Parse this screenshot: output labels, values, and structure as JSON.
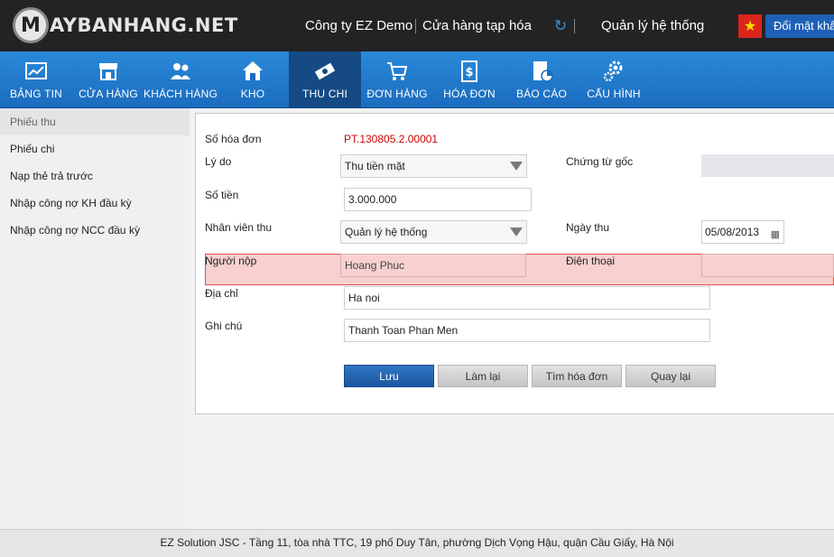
{
  "header": {
    "logo_letter": "M",
    "logo_text": "AYBANHANG.NET",
    "company": "Công ty EZ Demo",
    "store": "Cửa hàng tạp hóa",
    "user": "Quản lý hệ thống",
    "change_password": "Đổi mật khẩu",
    "sync_icon": "sync-icon",
    "flag_icon": "vietnam-flag-icon"
  },
  "nav": {
    "items": [
      {
        "label": "BẢNG TIN",
        "icon": "dashboard-icon"
      },
      {
        "label": "CỬA HÀNG",
        "icon": "store-icon"
      },
      {
        "label": "KHÁCH HÀNG",
        "icon": "customers-icon"
      },
      {
        "label": "KHO",
        "icon": "warehouse-icon"
      },
      {
        "label": "THU CHI",
        "icon": "cash-icon",
        "active": true
      },
      {
        "label": "ĐƠN HÀNG",
        "icon": "cart-icon"
      },
      {
        "label": "HÓA ĐƠN",
        "icon": "invoice-icon"
      },
      {
        "label": "BÁO CÁO",
        "icon": "report-icon"
      },
      {
        "label": "CẤU HÌNH",
        "icon": "settings-icon"
      }
    ]
  },
  "sidebar": {
    "items": [
      {
        "label": "Phiếu thu",
        "active": true
      },
      {
        "label": "Phiếu chi"
      },
      {
        "label": "Nạp thẻ trả trước"
      },
      {
        "label": "Nhập công nợ KH đầu kỳ"
      },
      {
        "label": "Nhập công nợ NCC đầu kỳ"
      }
    ]
  },
  "form": {
    "invoice_no_label": "Số hóa đơn",
    "invoice_no_value": "PT.130805.2.00001",
    "reason_label": "Lý do",
    "reason_value": "Thu tiền mặt",
    "source_doc_label": "Chứng từ gốc",
    "source_doc_value": "",
    "amount_label": "Số tiền",
    "amount_value": "3.000.000",
    "staff_label": "Nhân viên thu",
    "staff_value": "Quản lý hệ thống",
    "date_label": "Ngày thu",
    "date_value": "05/08/2013",
    "payer_label": "Người nộp",
    "payer_value": "Hoang Phuc",
    "phone_label": "Điện thoại",
    "phone_value": "",
    "address_label": "Địa chỉ",
    "address_value": "Ha noi",
    "note_label": "Ghi chú",
    "note_value": "Thanh Toan Phan Men"
  },
  "buttons": {
    "save": "Lưu",
    "reset": "Làm lại",
    "find_invoice": "Tìm hóa đơn",
    "back": "Quay lại"
  },
  "footer": {
    "text": "EZ Solution JSC - Tầng 11, tòa nhà TTC, 19 phố Duy Tân, phường Dịch Vọng Hậu, quận Cầu Giấy, Hà Nội"
  },
  "colors": {
    "nav_bg": "#1b6cbf",
    "nav_active": "#154a84",
    "invoice_red": "#cc0000",
    "highlight": "#e05050"
  }
}
